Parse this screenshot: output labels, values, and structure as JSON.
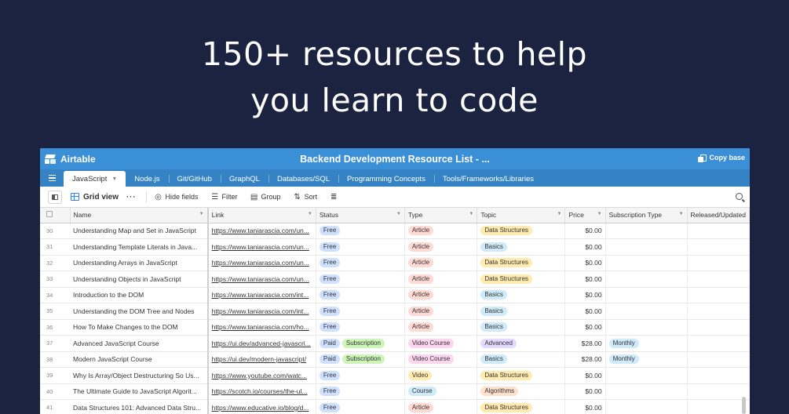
{
  "headline": {
    "line1": "150+ resources to help",
    "line2": "you learn to code"
  },
  "app": {
    "logo_text": "Airtable",
    "base_title": "Backend Development Resource List - ...",
    "copy_base": "Copy base"
  },
  "tabs": [
    "JavaScript",
    "Node.js",
    "Git/GitHub",
    "GraphQL",
    "Databases/SQL",
    "Programming Concepts",
    "Tools/Frameworks/Libraries"
  ],
  "toolbar": {
    "view_name": "Grid view",
    "more": "···",
    "hide_fields": "Hide fields",
    "filter": "Filter",
    "group": "Group",
    "sort": "Sort"
  },
  "columns": [
    "Name",
    "Link",
    "Status",
    "Type",
    "Topic",
    "Price",
    "Subscription Type",
    "Released/Updated"
  ],
  "colors": {
    "background": "#1b2340",
    "topbar": "#3b8fd6",
    "accent": "#2d7ff9"
  },
  "rows": [
    {
      "num": "30",
      "name": "Understanding Map and Set in JavaScript",
      "link": "https://www.taniarascia.com/un...",
      "status": [
        "Free"
      ],
      "type": "Article",
      "topic": "Data Structures",
      "price": "$0.00",
      "sub": ""
    },
    {
      "num": "31",
      "name": "Understanding Template Literals in Java...",
      "link": "https://www.taniarascia.com/un...",
      "status": [
        "Free"
      ],
      "type": "Article",
      "topic": "Basics",
      "price": "$0.00",
      "sub": ""
    },
    {
      "num": "32",
      "name": "Understanding Arrays in JavaScript",
      "link": "https://www.taniarascia.com/un...",
      "status": [
        "Free"
      ],
      "type": "Article",
      "topic": "Data Structures",
      "price": "$0.00",
      "sub": ""
    },
    {
      "num": "33",
      "name": "Understanding Objects in JavaScript",
      "link": "https://www.taniarascia.com/un...",
      "status": [
        "Free"
      ],
      "type": "Article",
      "topic": "Data Structures",
      "price": "$0.00",
      "sub": ""
    },
    {
      "num": "34",
      "name": "Introduction to the DOM",
      "link": "https://www.taniarascia.com/int...",
      "status": [
        "Free"
      ],
      "type": "Article",
      "topic": "Basics",
      "price": "$0.00",
      "sub": ""
    },
    {
      "num": "35",
      "name": "Understanding the DOM Tree and Nodes",
      "link": "https://www.taniarascia.com/int...",
      "status": [
        "Free"
      ],
      "type": "Article",
      "topic": "Basics",
      "price": "$0.00",
      "sub": ""
    },
    {
      "num": "36",
      "name": "How To Make Changes to the DOM",
      "link": "https://www.taniarascia.com/ho...",
      "status": [
        "Free"
      ],
      "type": "Article",
      "topic": "Basics",
      "price": "$0.00",
      "sub": ""
    },
    {
      "num": "37",
      "name": "Advanced JavaScript Course",
      "link": "https://ui.dev/advanced-javascri...",
      "status": [
        "Paid",
        "Subscription"
      ],
      "type": "Video Course",
      "topic": "Advanced",
      "price": "$28.00",
      "sub": "Monthly"
    },
    {
      "num": "38",
      "name": "Modern JavaScript Course",
      "link": "https://ui.dev/modern-javascript/",
      "status": [
        "Paid",
        "Subscription"
      ],
      "type": "Video Course",
      "topic": "Basics",
      "price": "$28.00",
      "sub": "Monthly"
    },
    {
      "num": "39",
      "name": "Why Is Array/Object Destructuring So Us...",
      "link": "https://www.youtube.com/watc...",
      "status": [
        "Free"
      ],
      "type": "Video",
      "topic": "Data Structures",
      "price": "$0.00",
      "sub": ""
    },
    {
      "num": "40",
      "name": "The Ultimate Guide to JavaScript Algorit...",
      "link": "https://scotch.io/courses/the-ul...",
      "status": [
        "Free"
      ],
      "type": "Course",
      "topic": "Algorithms",
      "price": "$0.00",
      "sub": ""
    },
    {
      "num": "41",
      "name": "Data Structures 101: Advanced Data Stru...",
      "link": "https://www.educative.io/blog/d...",
      "status": [
        "Free"
      ],
      "type": "Article",
      "topic": "Data Structures",
      "price": "$0.00",
      "sub": ""
    }
  ]
}
